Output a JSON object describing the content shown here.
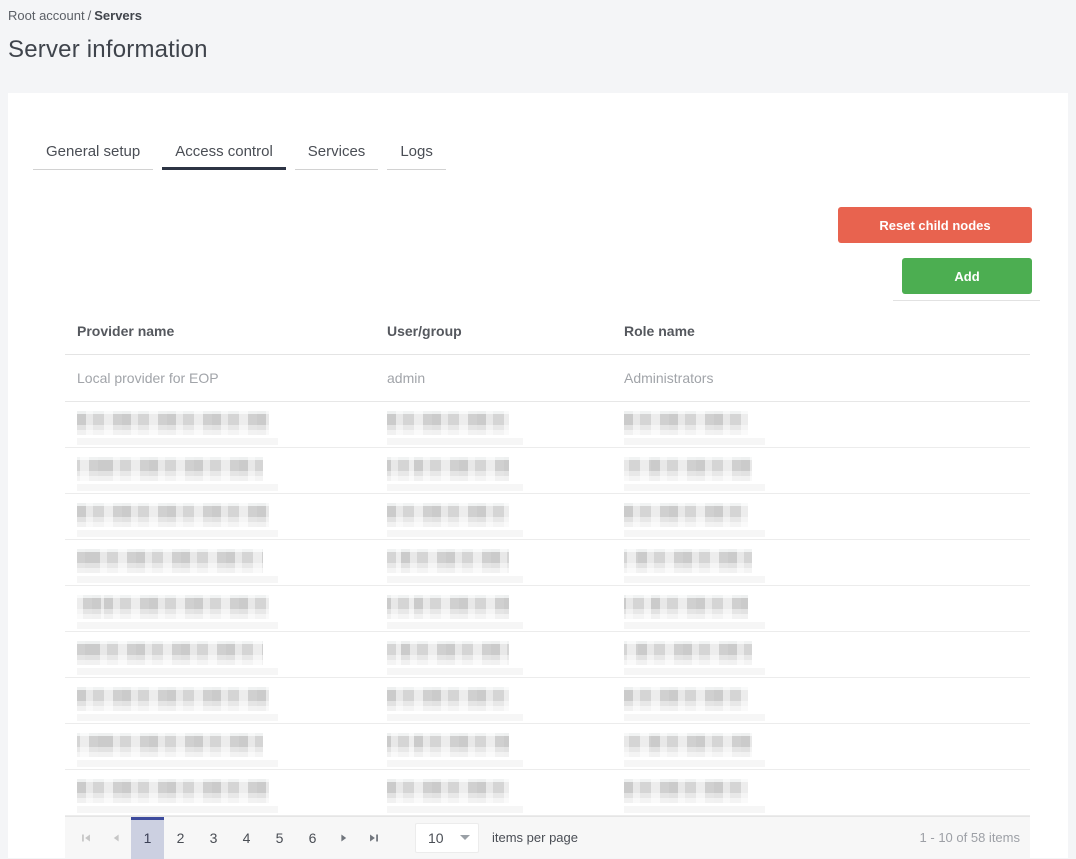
{
  "breadcrumb": {
    "root": "Root account",
    "separator": "/",
    "current": "Servers"
  },
  "page": {
    "title": "Server information"
  },
  "tabs": [
    {
      "label": "General setup",
      "active": false
    },
    {
      "label": "Access control",
      "active": true
    },
    {
      "label": "Services",
      "active": false
    },
    {
      "label": "Logs",
      "active": false
    }
  ],
  "actions": {
    "reset_label": "Reset child nodes",
    "add_label": "Add"
  },
  "table": {
    "columns": [
      "Provider name",
      "User/group",
      "Role name"
    ],
    "rows": [
      {
        "provider": "Local provider for EOP",
        "user_group": "admin",
        "role": "Administrators"
      }
    ],
    "redacted_row_count": 9
  },
  "pager": {
    "icons": [
      "seek-first-icon",
      "arrow-left-icon",
      "arrow-right-icon",
      "seek-end-icon"
    ],
    "pages": [
      "1",
      "2",
      "3",
      "4",
      "5",
      "6"
    ],
    "selected_page": "1",
    "page_size": "10",
    "items_per_page_label": "items per page",
    "info": "1 - 10 of 58 items"
  },
  "colors": {
    "danger_button": "#e8634f",
    "success_button": "#4cae51",
    "selected_page_bg": "#ccd0e1",
    "selected_page_border": "#3d4b9d"
  }
}
